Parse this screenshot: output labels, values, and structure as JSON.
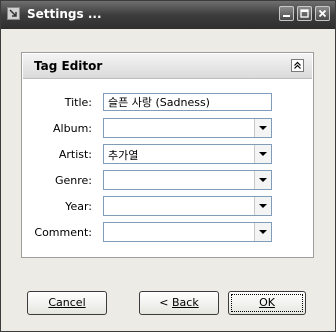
{
  "window": {
    "title": "Settings ...",
    "icon": "app-icon"
  },
  "titlebar_buttons": [
    "minimize-icon",
    "maximize-icon",
    "close-icon"
  ],
  "panel": {
    "title": "Tag Editor",
    "collapse_icon": "collapse-up-icon"
  },
  "fields": {
    "title": {
      "label": "Title:",
      "value": "슬픈 사랑 (Sadness)"
    },
    "album": {
      "label": "Album:",
      "value": ""
    },
    "artist": {
      "label": "Artist:",
      "value": "추가열"
    },
    "genre": {
      "label": "Genre:",
      "value": ""
    },
    "year": {
      "label": "Year:",
      "value": ""
    },
    "comment": {
      "label": "Comment:",
      "value": ""
    }
  },
  "buttons": {
    "cancel": {
      "label": "Cancel"
    },
    "back": {
      "prefix": "< ",
      "label": "Back"
    },
    "ok": {
      "label": "OK"
    }
  }
}
